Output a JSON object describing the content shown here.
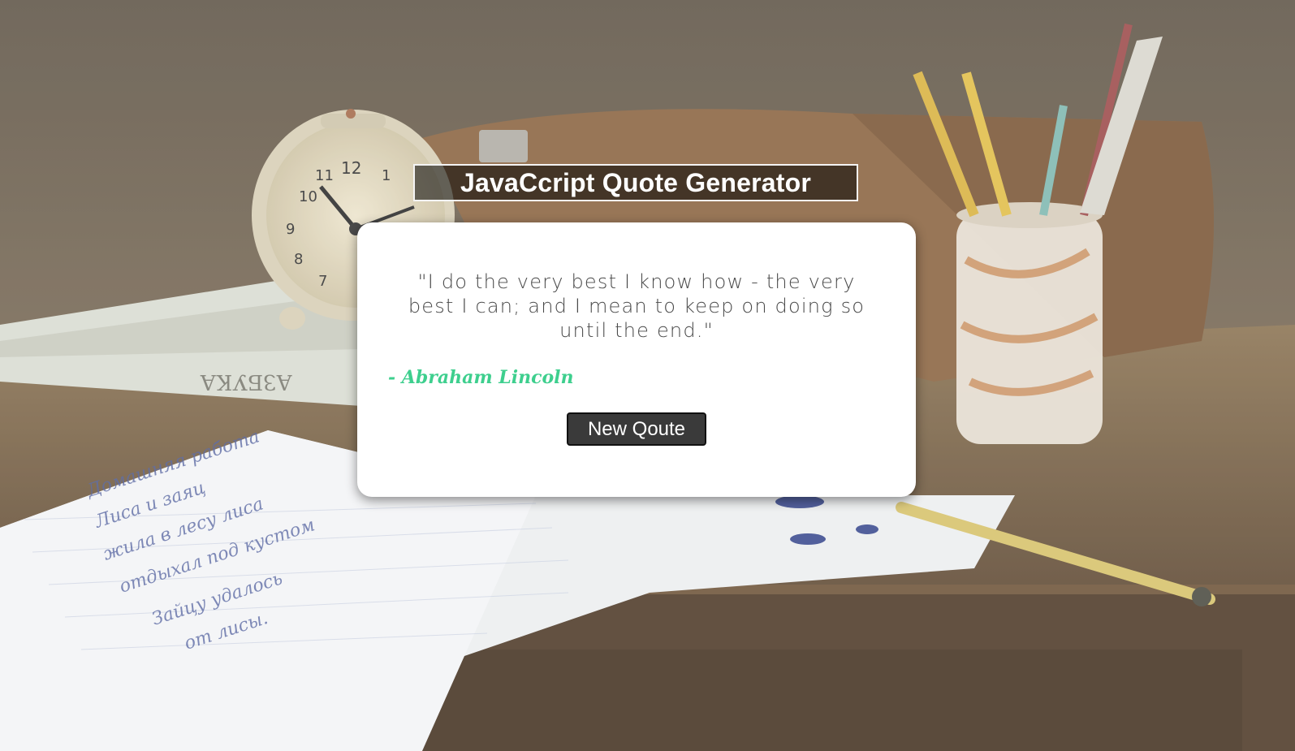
{
  "header": {
    "title": "JavaCcript Quote Generator"
  },
  "quote": {
    "text": "\"I do the very best I know how - the very best I can; and I mean to keep on doing so until the end.\"",
    "author": "- Abraham Lincoln"
  },
  "actions": {
    "new_quote_label": "New Qoute"
  },
  "colors": {
    "author": "#3ecf8e",
    "button_bg": "#3a3a3a",
    "card_bg": "#ffffff",
    "title_bg": "#2b2b2b"
  },
  "background": {
    "scene": "desk-still-life-photo"
  }
}
